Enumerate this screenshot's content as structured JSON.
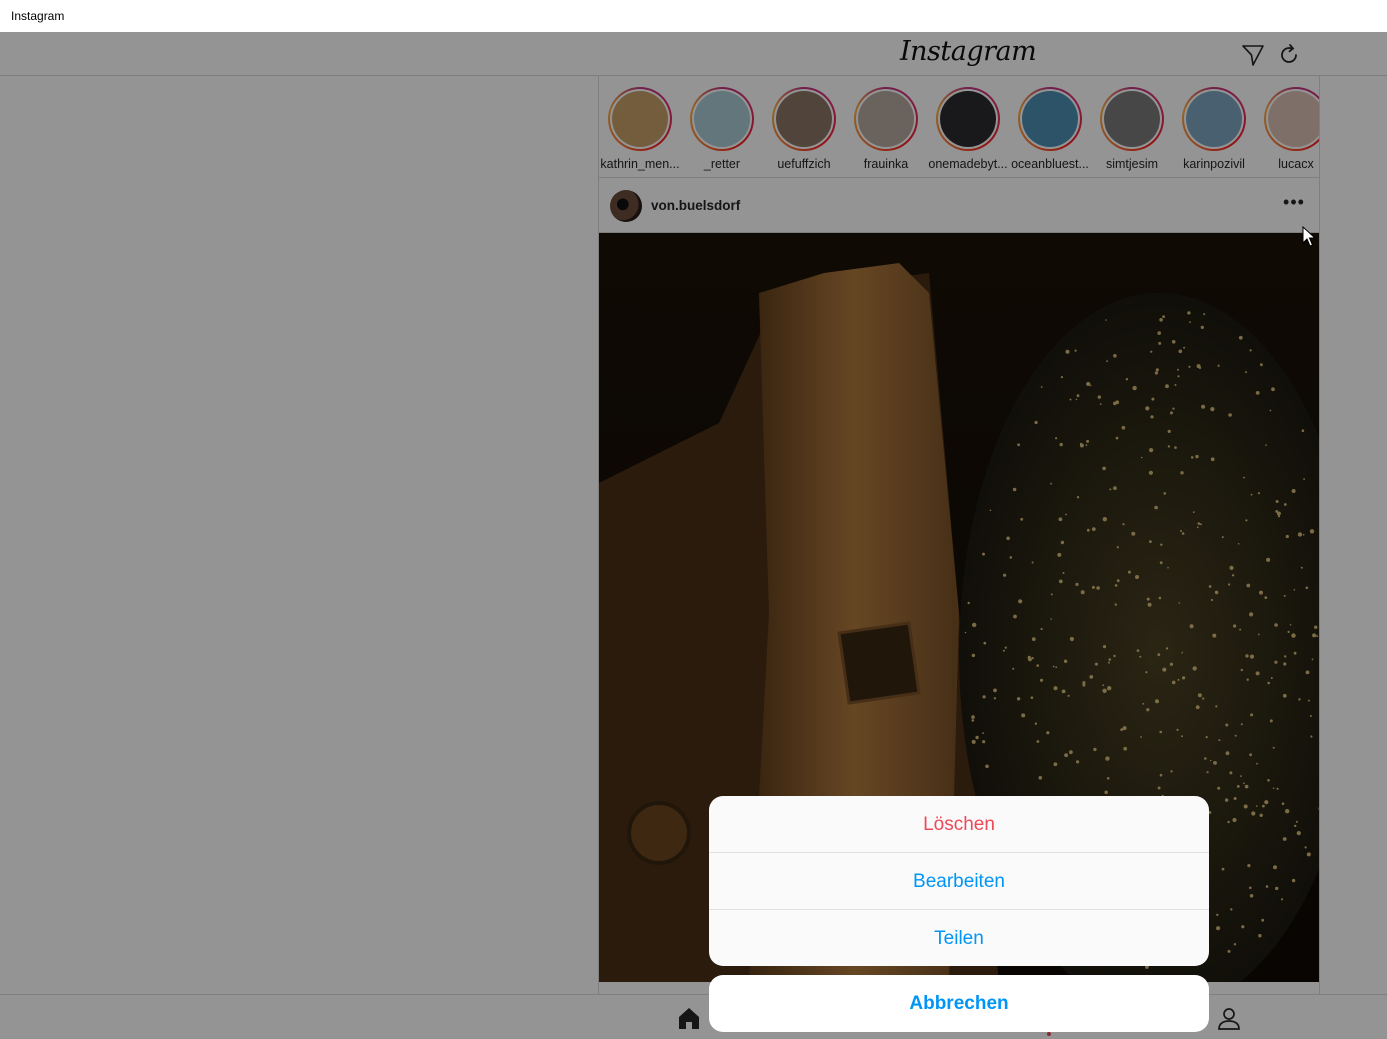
{
  "window": {
    "title": "Instagram"
  },
  "header": {
    "logo": "Instagram",
    "direct_icon": "paper-plane-icon",
    "refresh_icon": "refresh-icon"
  },
  "stories": [
    {
      "name": "kathrin_men...",
      "color": "#c9a06a"
    },
    {
      "name": "_retter",
      "color": "#a9cbd6"
    },
    {
      "name": "uefuffzich",
      "color": "#8a7566"
    },
    {
      "name": "frauinka",
      "color": "#b7a9a0"
    },
    {
      "name": "onemadebyt...",
      "color": "#2c2a30"
    },
    {
      "name": "oceanbluest...",
      "color": "#4f8fb5"
    },
    {
      "name": "simtjesim",
      "color": "#7a7a7a"
    },
    {
      "name": "karinpozivil",
      "color": "#7fa6c2"
    },
    {
      "name": "lucacx",
      "color": "#d9c2b5"
    }
  ],
  "post": {
    "username": "von.buelsdorf",
    "more_icon": "more-options-icon"
  },
  "action_sheet": {
    "delete": "Löschen",
    "edit": "Bearbeiten",
    "share": "Teilen",
    "cancel": "Abbrechen",
    "delete_color": "#ed4956",
    "action_color": "#0095f6"
  },
  "bottom_nav": {
    "home_icon": "home-icon",
    "profile_icon": "profile-icon"
  }
}
